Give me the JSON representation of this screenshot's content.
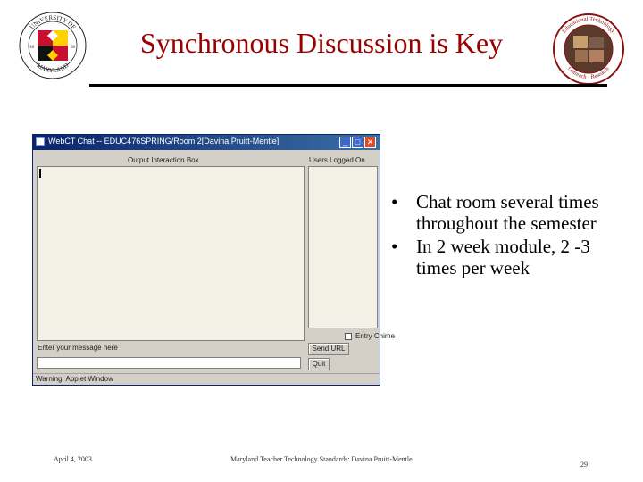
{
  "slide": {
    "title": "Synchronous Discussion is Key",
    "bullets": [
      "Chat room several times throughout the semester",
      "In 2 week module,  2 -3 times per week"
    ],
    "footer_date": "April 4, 2003",
    "footer_center": "Maryland Teacher Technology Standards: Davina Pruitt-Mentle",
    "page_number": "29"
  },
  "chat_window": {
    "title": "WebCT Chat -- EDUC476SPRING/Room 2[Davina Pruitt-Mentle]",
    "output_label": "Output Interaction Box",
    "users_label": "Users Logged On",
    "entry_chime_label": "Entry Chime",
    "message_label": "Enter your message here",
    "send_url_label": "Send URL",
    "quit_label": "Quit",
    "status_text": "Warning: Applet Window",
    "minimize_glyph": "_",
    "maximize_glyph": "□",
    "close_glyph": "✕"
  },
  "colors": {
    "title_red": "#990000",
    "maryland_red": "#c8102e",
    "maryland_gold": "#ffd200",
    "window_titlebar": "#0a246a"
  },
  "icons": {
    "left_logo": "university-of-maryland-seal",
    "right_logo": "educational-technology-outreach-seal"
  }
}
